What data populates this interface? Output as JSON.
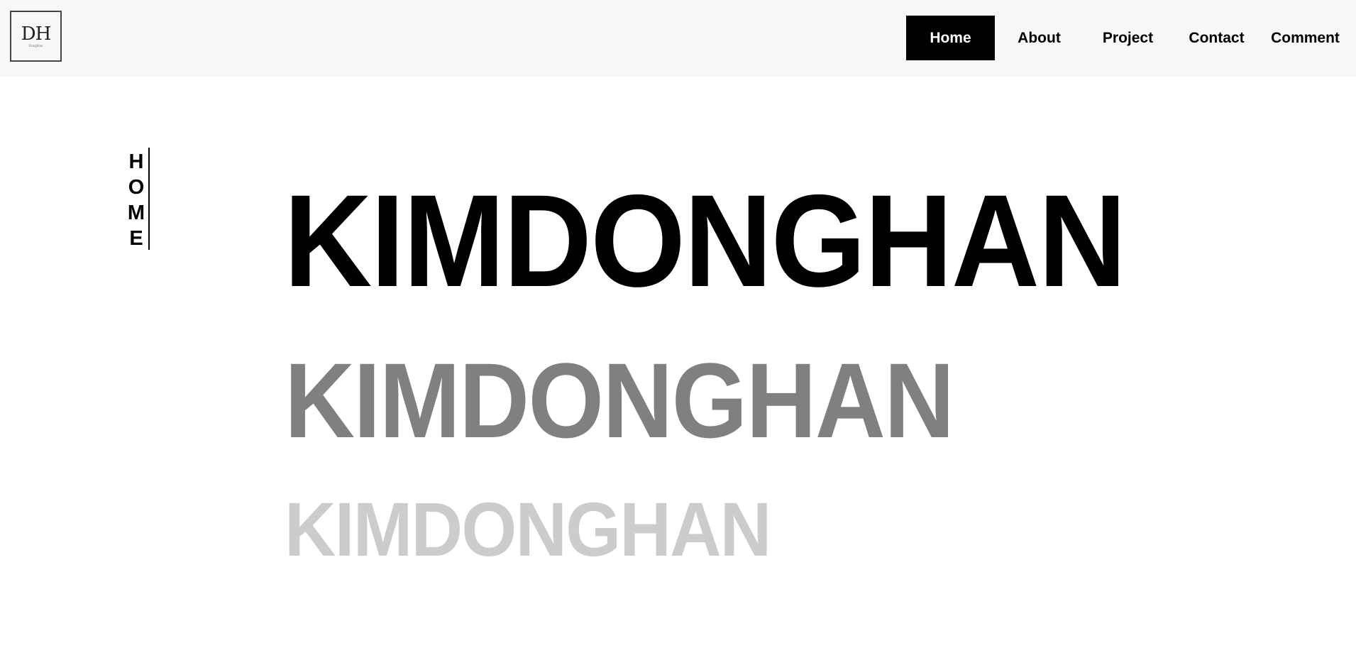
{
  "header": {
    "logo": {
      "mark": "DH",
      "subtext": "DongHan"
    },
    "nav": [
      {
        "label": "Home",
        "active": true
      },
      {
        "label": "About",
        "active": false
      },
      {
        "label": "Project",
        "active": false
      },
      {
        "label": "Contact",
        "active": false
      },
      {
        "label": "Comment",
        "active": false
      }
    ]
  },
  "main": {
    "section_label": "HOME",
    "hero_lines": [
      {
        "text": "KIMDONGHAN",
        "color": "#000000"
      },
      {
        "text": "KIMDONGHAN",
        "color": "#808080"
      },
      {
        "text": "KIMDONGHAN",
        "color": "#cccccc"
      }
    ]
  },
  "colors": {
    "header_bg": "#f7f7f7",
    "active_nav_bg": "#000000",
    "active_nav_text": "#ffffff",
    "text": "#000000"
  }
}
